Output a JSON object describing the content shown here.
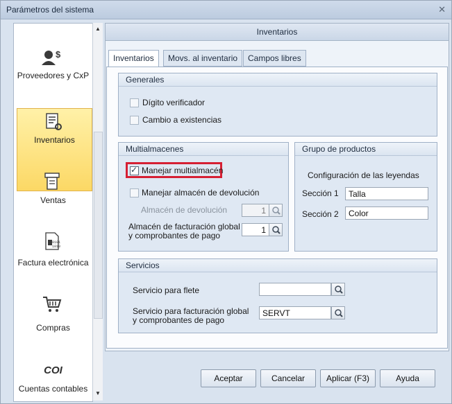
{
  "window": {
    "title": "Parámetros del sistema",
    "close_glyph": "✕"
  },
  "sidebar": {
    "items": [
      {
        "label": "Proveedores y CxP",
        "icon": "suppliers-icon"
      },
      {
        "label": "Inventarios",
        "icon": "inventory-icon",
        "active": true
      },
      {
        "label": "Ventas",
        "icon": "sales-icon"
      },
      {
        "label": "Factura electrónica",
        "icon": "electronic-invoice-icon"
      },
      {
        "label": "Compras",
        "icon": "shopping-cart-icon"
      },
      {
        "label": "Cuentas contables",
        "icon": "coi-icon",
        "icon_text": "COI"
      }
    ],
    "scroll_up": "▲",
    "scroll_down": "▼"
  },
  "main": {
    "header": "Inventarios",
    "tabs": [
      {
        "label": "Inventarios",
        "active": true
      },
      {
        "label": "Movs. al inventario"
      },
      {
        "label": "Campos libres"
      }
    ]
  },
  "generales": {
    "title": "Generales",
    "digito_label": "Dígito verificador",
    "cambio_label": "Cambio a existencias"
  },
  "multialmacenes": {
    "title": "Multialmacenes",
    "manejar_label": "Manejar multialmacén",
    "manejar_checked": true,
    "devolucion_label": "Manejar almacén de devolución",
    "almacen_dev_label": "Almacén de devolución",
    "almacen_dev_value": "1",
    "facturacion_label_1": "Almacén de facturación global",
    "facturacion_label_2": "y comprobantes de pago",
    "facturacion_value": "1"
  },
  "grupo": {
    "title": "Grupo de productos",
    "subtitle": "Configuración de las leyendas",
    "seccion1_label": "Sección 1",
    "seccion1_value": "Talla",
    "seccion2_label": "Sección 2",
    "seccion2_value": "Color"
  },
  "servicios": {
    "title": "Servicios",
    "flete_label": "Servicio para flete",
    "flete_value": "",
    "fact_label_1": "Servicio para facturación global",
    "fact_label_2": "y comprobantes de pago",
    "fact_value": "SERVT"
  },
  "buttons": {
    "aceptar": "Aceptar",
    "cancelar": "Cancelar",
    "aplicar": "Aplicar (F3)",
    "ayuda": "Ayuda"
  },
  "colors": {
    "highlight": "#d61f33",
    "active_item": "#fcd865"
  }
}
